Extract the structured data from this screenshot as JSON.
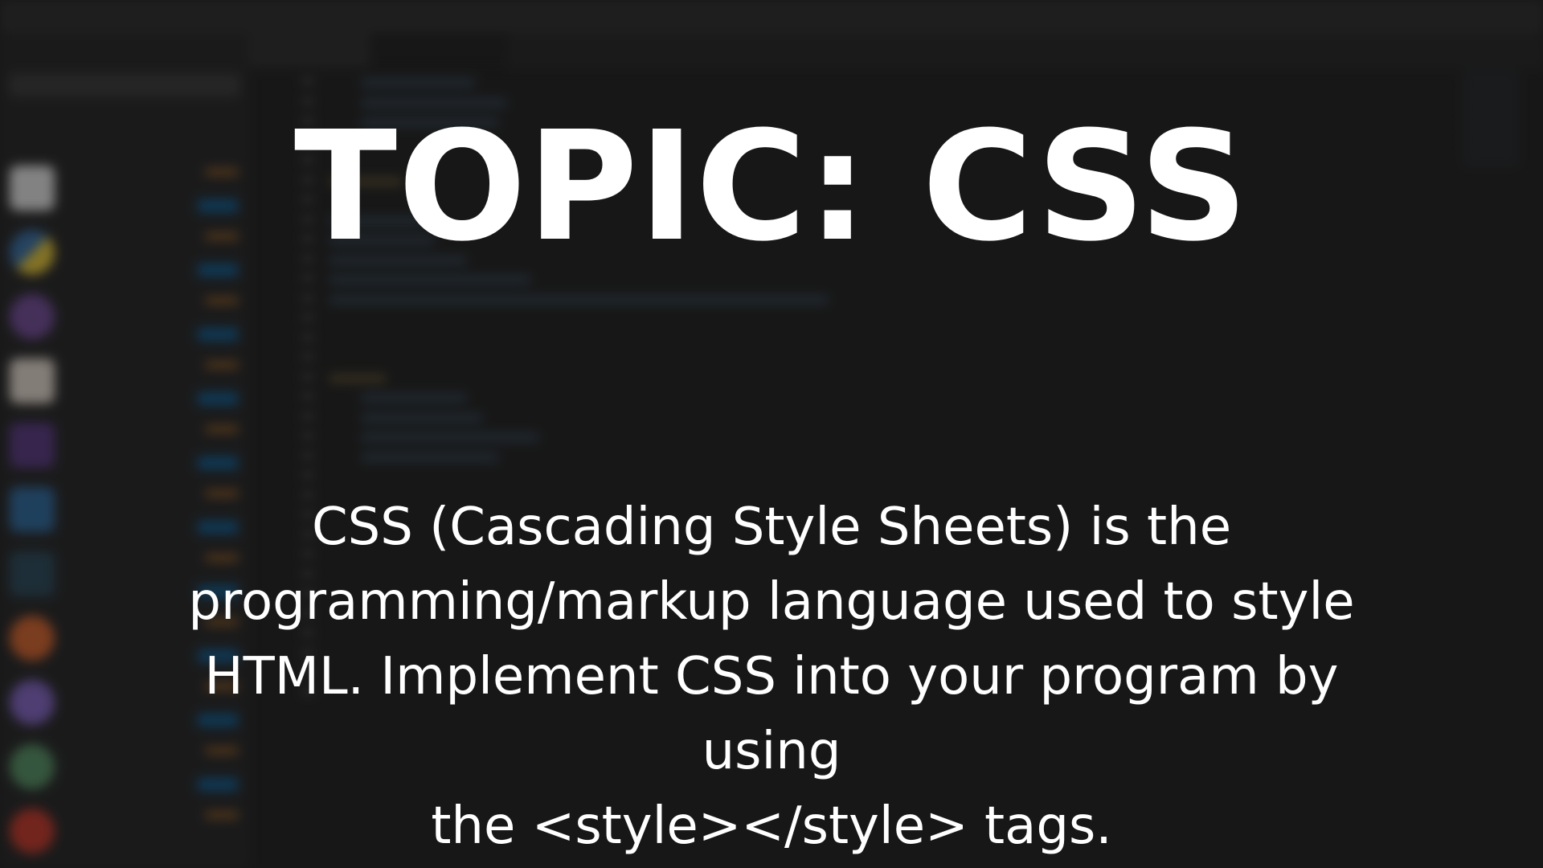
{
  "overlay": {
    "title": "TOPIC: CSS",
    "body_lines": [
      "CSS (Cascading Style Sheets) is the",
      "programming/markup language used to style",
      "HTML. Implement CSS into your program by using",
      "the <style></style> tags."
    ]
  },
  "colors": {
    "editor_bg": "#1e1e1e",
    "sidebar_bg": "#252526",
    "accent_blue": "#0e639c",
    "overlay_text": "#ffffff"
  }
}
